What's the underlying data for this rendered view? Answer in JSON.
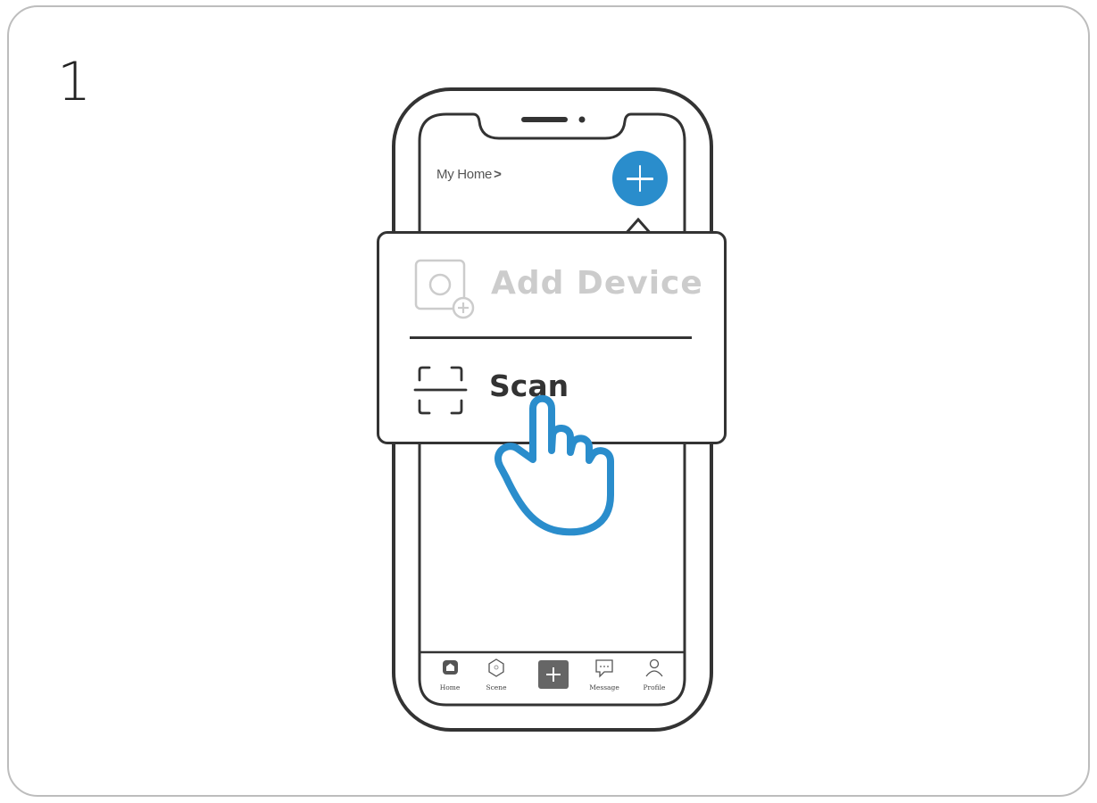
{
  "step_number": "1",
  "header": {
    "home_label": "My Home",
    "home_arrow": ">"
  },
  "popup": {
    "add_device_label": "Add Device",
    "scan_label": "Scan"
  },
  "tabbar": {
    "items": [
      {
        "label": "Home",
        "icon": "home-icon"
      },
      {
        "label": "Scene",
        "icon": "scene-icon"
      },
      {
        "label": "",
        "icon": "plus-icon"
      },
      {
        "label": "Message",
        "icon": "message-icon"
      },
      {
        "label": "Profile",
        "icon": "profile-icon"
      }
    ]
  },
  "colors": {
    "accent": "#2a8dcc",
    "stroke": "#333333",
    "muted": "#cccccc",
    "card_border": "#bdbdbd"
  },
  "hand_icon": "tap-hand-icon"
}
